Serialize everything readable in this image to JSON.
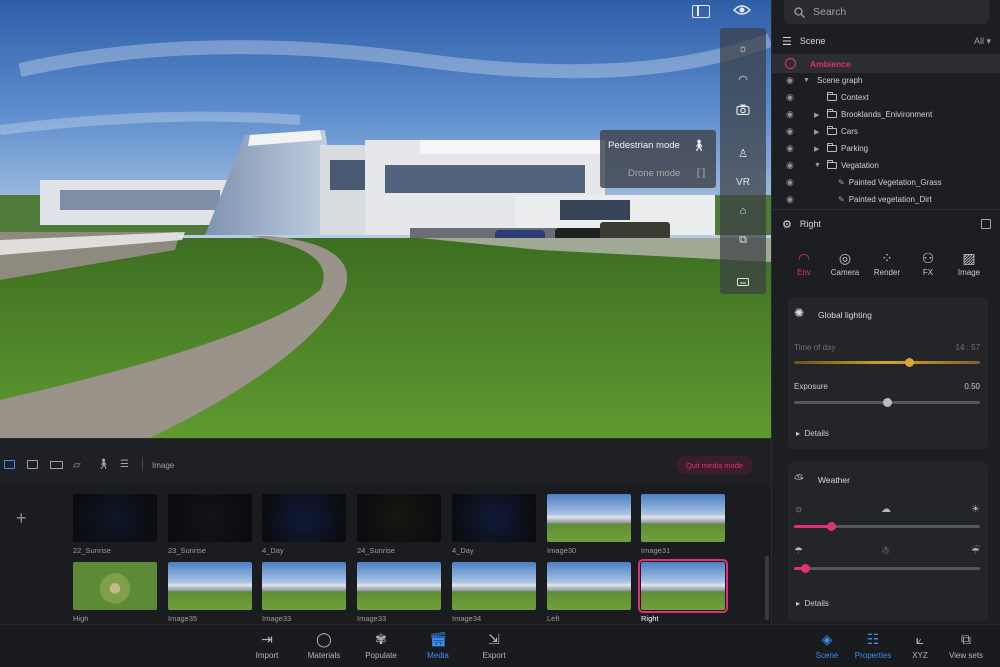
{
  "viewport": {
    "nav_menu": {
      "pedestrian": "Pedestrian mode",
      "drone": "Drone mode"
    },
    "tools": {
      "vr": "VR"
    }
  },
  "search": {
    "placeholder": "Search"
  },
  "scene": {
    "title": "Scene",
    "filter": "All",
    "ambience": "Ambience",
    "graph_title": "Scene graph",
    "items": [
      "Context",
      "Brooklands_Enivironment",
      "Cars",
      "Parking",
      "Vegatation",
      "Painted Vegetation_Grass",
      "Painted vegetation_Dirt"
    ]
  },
  "properties": {
    "title": "Right",
    "tabs": [
      "Env",
      "Camera",
      "Render",
      "FX",
      "Image"
    ],
    "global_lighting": {
      "title": "Global lighting",
      "time_label": "Time of day",
      "time_value": "14 : 57",
      "time_fraction": 0.62,
      "exposure_label": "Exposure",
      "exposure_value": "0.50",
      "exposure_fraction": 0.5,
      "details": "Details"
    },
    "weather": {
      "title": "Weather",
      "cloud_fraction": 0.2,
      "precip_fraction": 0.06,
      "details": "Details"
    }
  },
  "media": {
    "mode_label": "Image",
    "quit_button": "Quit media mode",
    "add_symbol": "+",
    "row1": [
      "22_Sunrise",
      "23_Sunrise",
      "4_Day",
      "24_Sunrise",
      "4_Day",
      "Image30",
      "Image31"
    ],
    "row2": [
      "High",
      "Image35",
      "Image33",
      "Image33",
      "Image34",
      "Left",
      "Right"
    ]
  },
  "bottom_nav": {
    "left": [
      "Import",
      "Materials",
      "Populate",
      "Media",
      "Export"
    ],
    "right": [
      "Scene",
      "Properties",
      "XYZ",
      "View sets"
    ]
  },
  "colors": {
    "accent_pink": "#e0307a",
    "accent_blue": "#3a8ff6"
  }
}
